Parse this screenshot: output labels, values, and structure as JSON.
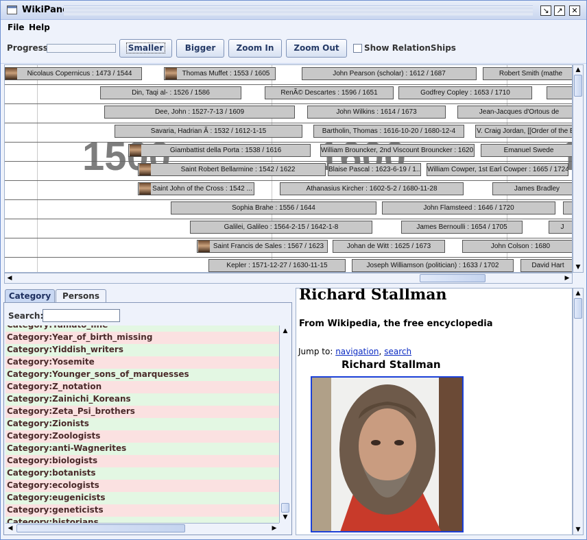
{
  "window": {
    "title": "WikiPane"
  },
  "menu": {
    "file": "File",
    "help": "Help"
  },
  "toolbar": {
    "progress_label": "Progress",
    "progress_value": 0,
    "smaller": "Smaller",
    "bigger": "Bigger",
    "zoom_in": "Zoom In",
    "zoom_out": "Zoom Out",
    "show_relationships": "Show RelationShips",
    "show_relationships_checked": false
  },
  "timeline": {
    "years": [
      "1500",
      "1600",
      "1"
    ],
    "rows": [
      [
        "Nicolaus Copernicus : 1473  / 1544",
        "Thomas Muffet : 1553  / 1605",
        "John Pearson (scholar) : 1612  / 1687",
        "Robert Smith (mathe"
      ],
      [
        "Din, Taqi al- : 1526  / 1586",
        "RenÃ© Descartes : 1596  / 1651",
        "Godfrey Copley : 1653  / 1710",
        ""
      ],
      [
        "Dee, John : 1527-7-13  / 1609",
        "John Wilkins : 1614  / 1673",
        "Jean-Jacques d'Ortous de"
      ],
      [
        "Savaria, Hadrian Ã  : 1532  / 1612-1-15",
        "Bartholin, Thomas : 1616-10-20  / 1680-12-4",
        "V. Craig Jordan, [[Order of the Br"
      ],
      [
        "Giambattist della Porta : 1538  / 1616",
        "William Brouncker, 2nd Viscount Brouncker : 1620 ...",
        "Emanuel Swede"
      ],
      [
        "Saint Robert Bellarmine : 1542  / 1622",
        "Blaise Pascal : 1623-6-19  / 1...",
        "William Cowper, 1st Earl Cowper : 1665  / 1724"
      ],
      [
        "Saint John of the Cross : 1542  ...",
        "Athanasius Kircher : 1602-5-2  / 1680-11-28",
        "James Bradley"
      ],
      [
        "Sophia Brahe : 1556  / 1644",
        "John Flamsteed : 1646  / 1720",
        ""
      ],
      [
        "Galilei, Galileo : 1564-2-15  / 1642-1-8",
        "James Bernoulli : 1654  / 1705",
        "J"
      ],
      [
        "Saint Francis de Sales : 1567  / 1623",
        "Johan de Witt : 1625  / 1673",
        "John Colson : 1680"
      ],
      [
        "Kepler : 1571-12-27  / 1630-11-15",
        "Joseph Williamson (politician) : 1633  / 1702",
        "David Hart"
      ]
    ]
  },
  "tabs": {
    "category": "Category",
    "persons": "Persons"
  },
  "search": {
    "label": "Search:",
    "value": ""
  },
  "categories": [
    "Category:Yamato_line",
    "Category:Year_of_birth_missing",
    "Category:Yiddish_writers",
    "Category:Yosemite",
    "Category:Younger_sons_of_marquesses",
    "Category:Z_notation",
    "Category:Zainichi_Koreans",
    "Category:Zeta_Psi_brothers",
    "Category:Zionists",
    "Category:Zoologists",
    "Category:anti-Wagnerites",
    "Category:biologists",
    "Category:botanists",
    "Category:ecologists",
    "Category:eugenicists",
    "Category:geneticists",
    "Category:historians"
  ],
  "article": {
    "title": "Richard Stallman",
    "subtitle": "From Wikipedia, the free encyclopedia",
    "jump_prefix": "Jump to:",
    "jump_nav": "navigation",
    "jump_sep": ",",
    "jump_search": "search",
    "caption": "Richard Stallman"
  }
}
